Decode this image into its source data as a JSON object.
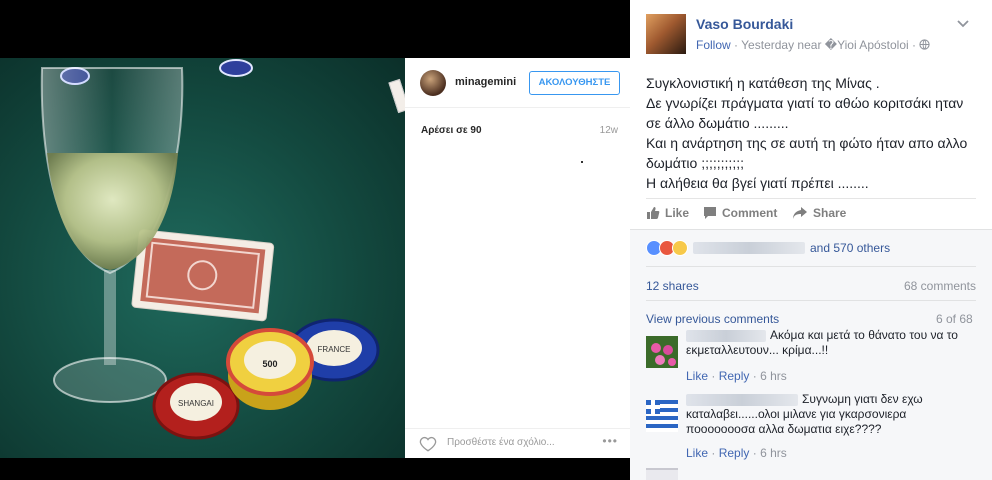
{
  "instagram": {
    "username": "minagemini",
    "follow_label": "ΑΚΟΛΟΥΘΗΣΤΕ",
    "likes": "Αρέσει σε 90",
    "time": "12w",
    "comment_placeholder": "Προσθέστε ένα σχόλιο...",
    "more": "•••"
  },
  "photo": {
    "chip_labels": [
      "500",
      "SHANGAI",
      "FRANCE"
    ]
  },
  "post": {
    "author": "Vaso Bourdaki",
    "follow": "Follow",
    "meta_sep": "·",
    "meta_time": "Yesterday near �Yioi Apóstoloi ·",
    "text_lines": [
      "Συγκλονιστική η κατάθεση της Μίνας .",
      "Δε γνωρίζει πράγματα γιατί το αθώο κοριτσάκι ηταν",
      "σε άλλο δωμάτιο .........",
      "Και η ανάρτηση της σε αυτή τη φώτο ήταν απο αλλο",
      "δωμάτιο ;;;;;;;;;;;",
      "Η αλήθεια θα βγεί γιατί πρέπει ........"
    ],
    "actions": {
      "like": "Like",
      "comment": "Comment",
      "share": "Share"
    },
    "reactions_others": "and 570 others",
    "shares": "12 shares",
    "comments_count": "68 comments",
    "view_previous": "View previous comments",
    "page_count": "6 of 68"
  },
  "comments": [
    {
      "lines": [
        "Ακόμα και μετά το θάνατο του να το",
        "εκμεταλλευτουν... κρίμα...!!"
      ],
      "like": "Like",
      "reply": "Reply",
      "time": "6 hrs",
      "sep": "·"
    },
    {
      "lines": [
        "Συγνωμη γιατι δεν εχω",
        "καταλαβει......ολοι μιλανε για γκαρσονιερα",
        "ποοοοοοοσα αλλα δωματια ειχε????"
      ],
      "like": "Like",
      "reply": "Reply",
      "time": "6 hrs",
      "sep": "·"
    }
  ],
  "colors": {
    "fb_blue": "#365899",
    "link_blue": "#4267b2",
    "ig_blue": "#3897f0",
    "felt_green": "#1f6a5d"
  }
}
